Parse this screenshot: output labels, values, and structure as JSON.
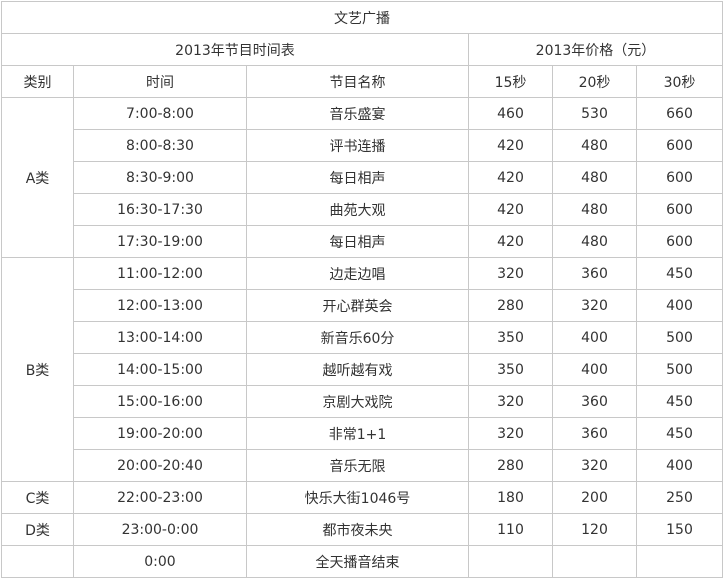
{
  "table": {
    "title": "文艺广播",
    "schedule_header": "2013年节目时间表",
    "price_header": "2013年价格（元）",
    "columns": {
      "category": "类别",
      "time": "时间",
      "program": "节目名称",
      "p15": "15秒",
      "p20": "20秒",
      "p30": "30秒"
    },
    "categories": [
      "A类",
      "B类",
      "C类",
      "D类"
    ],
    "rows": [
      {
        "time": "7:00-8:00",
        "program": "音乐盛宴",
        "p15": "460",
        "p20": "530",
        "p30": "660"
      },
      {
        "time": "8:00-8:30",
        "program": "评书连播",
        "p15": "420",
        "p20": "480",
        "p30": "600"
      },
      {
        "time": "8:30-9:00",
        "program": "每日相声",
        "p15": "420",
        "p20": "480",
        "p30": "600"
      },
      {
        "time": "16:30-17:30",
        "program": "曲苑大观",
        "p15": "420",
        "p20": "480",
        "p30": "600"
      },
      {
        "time": "17:30-19:00",
        "program": "每日相声",
        "p15": "420",
        "p20": "480",
        "p30": "600"
      },
      {
        "time": "11:00-12:00",
        "program": "边走边唱",
        "p15": "320",
        "p20": "360",
        "p30": "450"
      },
      {
        "time": "12:00-13:00",
        "program": "开心群英会",
        "p15": "280",
        "p20": "320",
        "p30": "400"
      },
      {
        "time": "13:00-14:00",
        "program": "新音乐60分",
        "p15": "350",
        "p20": "400",
        "p30": "500"
      },
      {
        "time": "14:00-15:00",
        "program": "越听越有戏",
        "p15": "350",
        "p20": "400",
        "p30": "500"
      },
      {
        "time": "15:00-16:00",
        "program": "京剧大戏院",
        "p15": "320",
        "p20": "360",
        "p30": "450"
      },
      {
        "time": "19:00-20:00",
        "program": "非常1+1",
        "p15": "320",
        "p20": "360",
        "p30": "450"
      },
      {
        "time": "20:00-20:40",
        "program": "音乐无限",
        "p15": "280",
        "p20": "320",
        "p30": "400"
      },
      {
        "time": "22:00-23:00",
        "program": "快乐大街1046号",
        "p15": "180",
        "p20": "200",
        "p30": "250"
      },
      {
        "time": "23:00-0:00",
        "program": "都市夜未央",
        "p15": "110",
        "p20": "120",
        "p30": "150"
      },
      {
        "time": "0:00",
        "program": "全天播音结束",
        "p15": "",
        "p20": "",
        "p30": ""
      }
    ]
  }
}
